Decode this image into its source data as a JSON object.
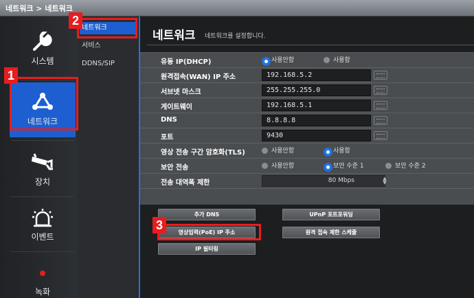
{
  "breadcrumb": "네트워크 > 네트워크",
  "sidebar": {
    "items": [
      {
        "label": "시스템",
        "icon": "wrench-icon"
      },
      {
        "label": "네트워크",
        "icon": "network-icon"
      },
      {
        "label": "장치",
        "icon": "camera-icon"
      },
      {
        "label": "이벤트",
        "icon": "alarm-icon"
      },
      {
        "label": "녹화",
        "icon": "record-dot-icon"
      }
    ]
  },
  "submenu": {
    "items": [
      {
        "label": "네트워크"
      },
      {
        "label": "서비스"
      },
      {
        "label": "DDNS/SIP"
      }
    ]
  },
  "page": {
    "title": "네트워크",
    "subtitle": "네트워크를 설정합니다."
  },
  "settings": {
    "dhcp": {
      "label": "유동 IP(DHCP)",
      "opt_off": "사용안함",
      "opt_on": "사용함"
    },
    "wan_ip": {
      "label": "원격접속(WAN) IP 주소",
      "value": "192.168.5.2"
    },
    "subnet": {
      "label": "서브넷 마스크",
      "value": "255.255.255.0"
    },
    "gateway": {
      "label": "게이트웨이",
      "value": "192.168.5.1"
    },
    "dns": {
      "label": "DNS",
      "value": "8.8.8.8"
    },
    "port": {
      "label": "포트",
      "value": "9430"
    },
    "tls": {
      "label": "영상 전송 구간 암호화(TLS)",
      "opt_off": "사용안함",
      "opt_on": "사용함"
    },
    "secure": {
      "label": "보안 전송",
      "opt_off": "사용안함",
      "opt_l1": "보안 수준 1",
      "opt_l2": "보안 수준 2"
    },
    "bandwidth": {
      "label": "전송 대역폭 제한",
      "value": "80 Mbps"
    }
  },
  "buttons": {
    "add_dns": "추가 DNS",
    "upnp": "UPnP 포트포워딩",
    "poe_ip": "영상입력(PoE) IP 주소",
    "remote_schedule": "원격 접속 제한 스케쥴",
    "ip_filter": "IP 필터링"
  },
  "markers": [
    "1",
    "2",
    "3"
  ],
  "colors": {
    "accent": "#1d5fd0",
    "marker": "#e81d1d"
  }
}
